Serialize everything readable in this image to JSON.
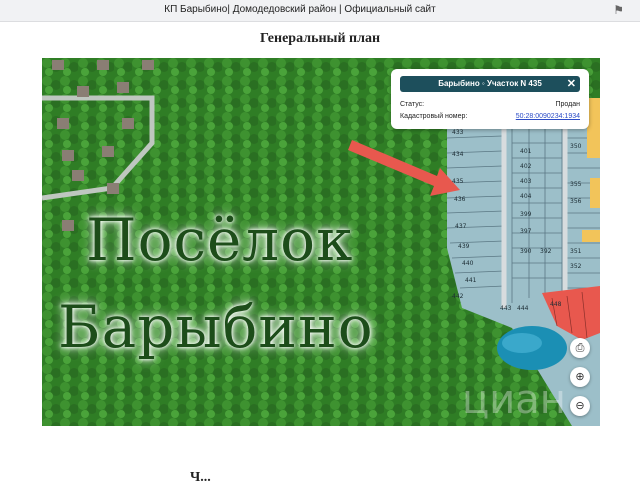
{
  "browser": {
    "tab_title": "КП Барыбино| Домодедовский район | Официальный сайт",
    "bookmark_icon": "bookmark-icon"
  },
  "page": {
    "title": "Генеральный план"
  },
  "map": {
    "title_line1": "Посёлок",
    "title_line2": "Барыбино",
    "watermark": "циан",
    "plot_labels": [
      "433",
      "434",
      "435",
      "436",
      "437",
      "438",
      "439",
      "440",
      "441",
      "442",
      "443",
      "444",
      "445",
      "446",
      "447",
      "448",
      "401",
      "402",
      "403",
      "404",
      "397",
      "398",
      "399",
      "400",
      "389",
      "390",
      "392",
      "394",
      "395",
      "396",
      "350",
      "351",
      "352",
      "353",
      "354",
      "355",
      "356",
      "342",
      "340",
      "341",
      "343"
    ],
    "colors": {
      "sold": "#9cbfc9",
      "free": "#e8584e",
      "reserved": "#f2c45a",
      "forest": "#2f7d25",
      "water": "#1b8fb4"
    }
  },
  "info_popup": {
    "header": "Барыбино ◦ Участок N 435",
    "status_label": "Статус:",
    "status_value": "Продан",
    "cadastral_label": "Кадастровый номер:",
    "cadastral_value": "50:28:0090234:1934"
  },
  "controls": {
    "print_icon": "print-icon",
    "zoom_in_icon": "zoom-in-icon",
    "zoom_out_icon": "zoom-out-icon"
  },
  "footer": {
    "partial_text": "Ч..."
  }
}
